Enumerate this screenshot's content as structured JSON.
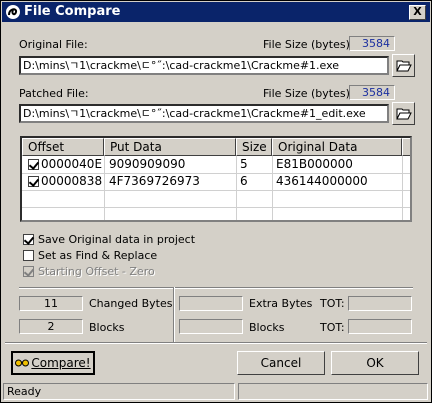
{
  "window": {
    "title": "File Compare",
    "close_glyph": "X",
    "title_icon": "knot-app-icon"
  },
  "original": {
    "label": "Original File:",
    "size_label": "File Size (bytes):",
    "size_value": "3584",
    "path": "D:\\mins\\ㄱ1\\crackme\\ㄷ°˝:\\cad-crackme1\\Crackme#1.exe",
    "browse_icon": "folder-open-icon"
  },
  "patched": {
    "label": "Patched File:",
    "size_label": "File Size (bytes):",
    "size_value": "3584",
    "path": "D:\\mins\\ㄱ1\\crackme\\ㄷ°˝:\\cad-crackme1\\Crackme#1_edit.exe",
    "browse_icon": "folder-open-icon"
  },
  "table": {
    "columns": [
      "Offset",
      "Put Data",
      "Size",
      "Original Data"
    ],
    "rows": [
      {
        "checked": true,
        "offset": "0000040E",
        "put_data": "9090909090",
        "size": "5",
        "original_data": "E81B000000"
      },
      {
        "checked": true,
        "offset": "00000838",
        "put_data": "4F7369726973",
        "size": "6",
        "original_data": "436144000000"
      }
    ]
  },
  "options": {
    "save_original": {
      "label": "Save Original data in project",
      "checked": true
    },
    "find_replace": {
      "label": "Set as Find & Replace",
      "checked": false
    },
    "starting_offset": {
      "label": "Starting Offset - Zero",
      "checked": true,
      "disabled": true
    }
  },
  "stats": {
    "changed_bytes_value": "11",
    "changed_bytes_label": "Changed Bytes",
    "blocks_value": "2",
    "blocks_label": "Blocks",
    "extra_bytes_value": "",
    "extra_bytes_label": "Extra Bytes",
    "extra_blocks_value": "",
    "extra_blocks_label": "Blocks",
    "tot_label_1": "TOT:",
    "tot_value_1": "",
    "tot_label_2": "TOT:",
    "tot_value_2": ""
  },
  "buttons": {
    "compare": "Compare!",
    "cancel": "Cancel",
    "ok": "OK"
  },
  "status": {
    "text": "Ready",
    "pane2": ""
  }
}
